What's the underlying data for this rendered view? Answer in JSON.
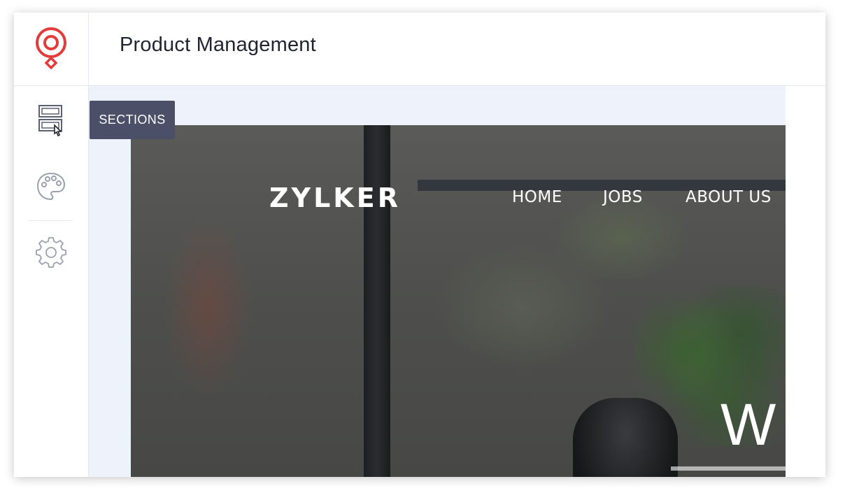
{
  "header": {
    "title": "Product Management"
  },
  "sidebar": {
    "items": [
      {
        "name": "sections",
        "icon": "sections-icon"
      },
      {
        "name": "themes",
        "icon": "palette-icon"
      },
      {
        "name": "settings",
        "icon": "gear-icon"
      }
    ],
    "tooltip": "SECTIONS"
  },
  "preview": {
    "brand": "ZYLKER",
    "nav": [
      "HOME",
      "JOBS",
      "ABOUT US"
    ],
    "hero_text": "W"
  },
  "colors": {
    "accent_red": "#e43b3b",
    "tooltip_bg": "#4b5068",
    "canvas_bg": "#eef2fb"
  }
}
